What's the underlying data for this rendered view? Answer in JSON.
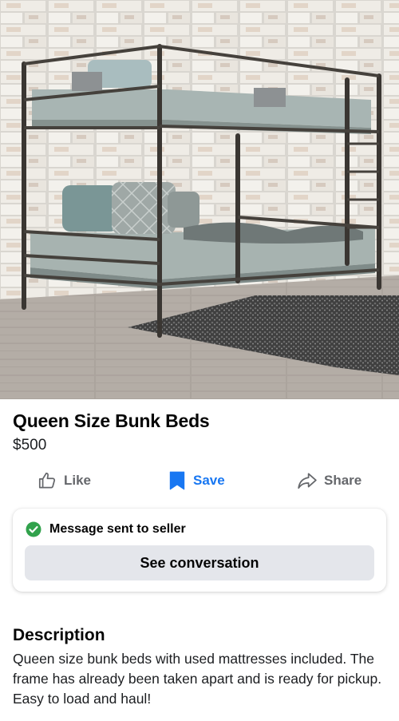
{
  "listing": {
    "title": "Queen Size Bunk Beds",
    "price": "$500"
  },
  "actions": {
    "like_label": "Like",
    "save_label": "Save",
    "share_label": "Share",
    "like_icon": "thumbs-up-icon",
    "save_icon": "bookmark-icon",
    "share_icon": "share-arrow-icon"
  },
  "message_card": {
    "status_text": "Message sent to seller",
    "status_icon": "check-circle-icon",
    "button_label": "See conversation"
  },
  "description": {
    "heading": "Description",
    "body": "Queen size bunk beds with used mattresses included. The frame has already been taken apart and is ready for pickup. Easy to load and haul!"
  },
  "colors": {
    "accent": "#1877f2",
    "success": "#31a24c",
    "muted": "#65676b",
    "button_bg": "#e4e6eb"
  }
}
